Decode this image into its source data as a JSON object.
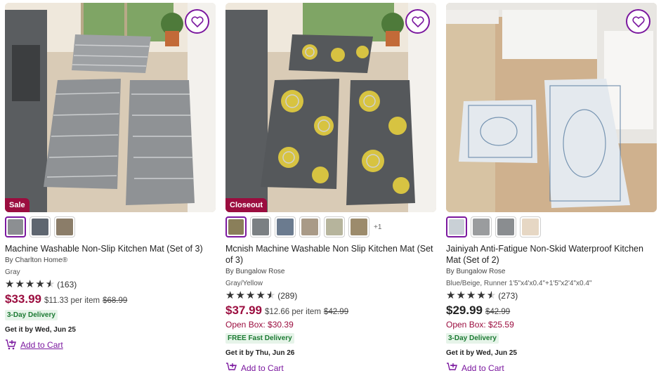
{
  "products": [
    {
      "badge": "Sale",
      "title": "Machine Washable Non-Slip Kitchen Mat (Set of 3)",
      "brand": "By Charlton Home®",
      "variant": "Gray",
      "review_count": "(163)",
      "rating": 4.5,
      "price": "$33.99",
      "per_item": "$11.33 per item",
      "was_price": "$68.99",
      "open_box": "",
      "shipping_badge": "3-Day Delivery",
      "delivery": "Get it by Wed, Jun 25",
      "add_to_cart": "Add to Cart",
      "swatch_more": ""
    },
    {
      "badge": "Closeout",
      "title": "Mcnish Machine Washable Non Slip Kitchen Mat (Set of 3)",
      "brand": "By Bungalow Rose",
      "variant": "Gray/Yellow",
      "review_count": "(289)",
      "rating": 4.5,
      "price": "$37.99",
      "per_item": "$12.66 per item",
      "was_price": "$42.99",
      "open_box": "Open Box: $30.39",
      "shipping_badge": "FREE Fast Delivery",
      "delivery": "Get it by Thu, Jun 26",
      "add_to_cart": "Add to Cart",
      "swatch_more": "+1"
    },
    {
      "badge": "",
      "title": "Jainiyah Anti-Fatigue Non-Skid Waterproof Kitchen Mat (Set of 2)",
      "brand": "By Bungalow Rose",
      "variant": "Blue/Beige, Runner 1'5\"x4'x0.4\"+1'5\"x2'4\"x0.4\"",
      "review_count": "(273)",
      "rating": 4.5,
      "price": "$29.99",
      "per_item": "",
      "was_price": "$42.99",
      "open_box": "Open Box: $25.59",
      "shipping_badge": "3-Day Delivery",
      "delivery": "Get it by Wed, Jun 25",
      "add_to_cart": "Add to Cart",
      "swatch_more": ""
    }
  ],
  "colors": {
    "accent": "#7b189f",
    "sale_red": "#9b0d3f",
    "ship_green": "#1c7a33"
  },
  "icons": [
    "heart-icon",
    "star-icon",
    "cart-plus-icon"
  ]
}
